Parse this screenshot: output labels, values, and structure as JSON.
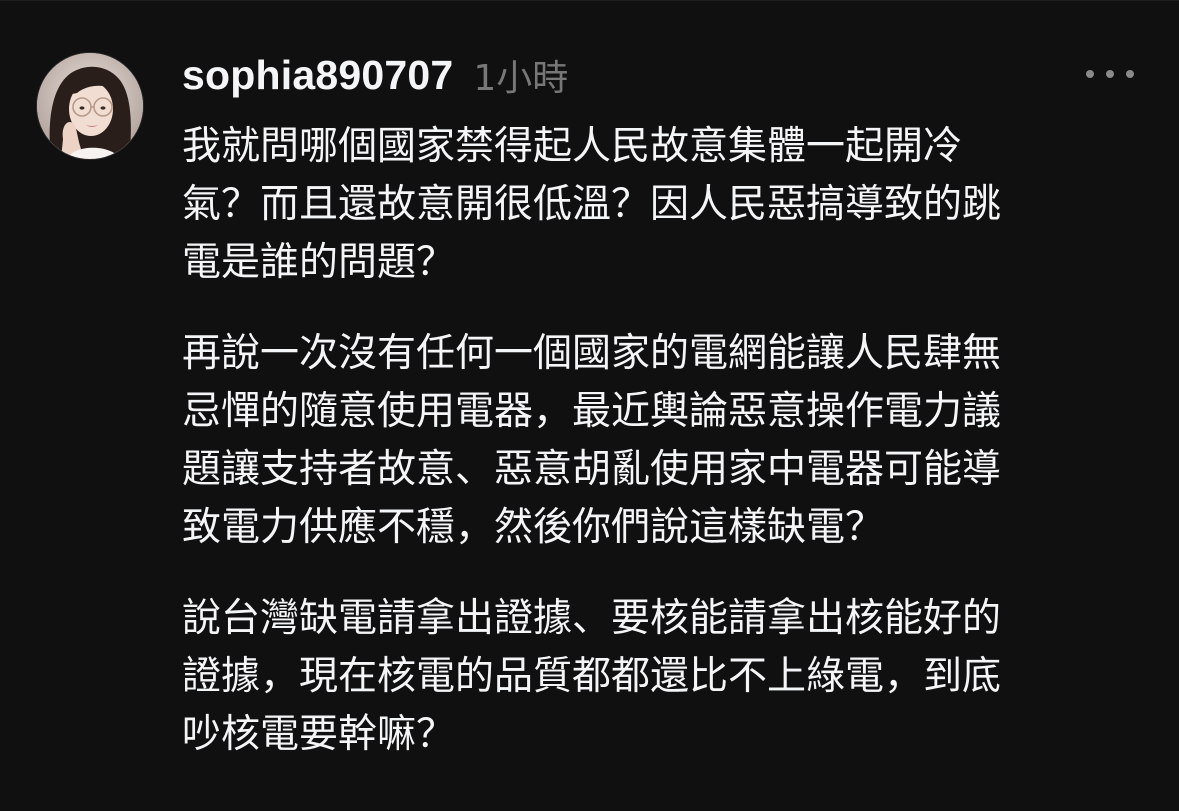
{
  "post": {
    "username": "sophia890707",
    "timestamp": "1小時",
    "more_icon": "ellipsis-horizontal-icon",
    "avatar_icon": "profile-photo-avatar",
    "paragraphs": [
      {
        "lines": [
          "我就問哪個國家禁得起人民故意集體一起開冷",
          "氣？而且還故意開很低溫？因人民惡搞導致的跳",
          "電是誰的問題？"
        ]
      },
      {
        "lines": [
          "再說一次沒有任何一個國家的電網能讓人民肆無",
          "忌憚的隨意使用電器，最近輿論惡意操作電力議",
          "題讓支持者故意、惡意胡亂使用家中電器可能導",
          "致電力供應不穩，然後你們說這樣缺電？"
        ]
      },
      {
        "lines": [
          "說台灣缺電請拿出證據、要核能請拿出核能好的",
          "證據，現在核電的品質都都還比不上綠電，到底",
          "吵核電要幹嘛？"
        ]
      }
    ]
  },
  "colors": {
    "background": "#101010",
    "primary_text": "#f3f5f7",
    "secondary_text": "#777777"
  }
}
